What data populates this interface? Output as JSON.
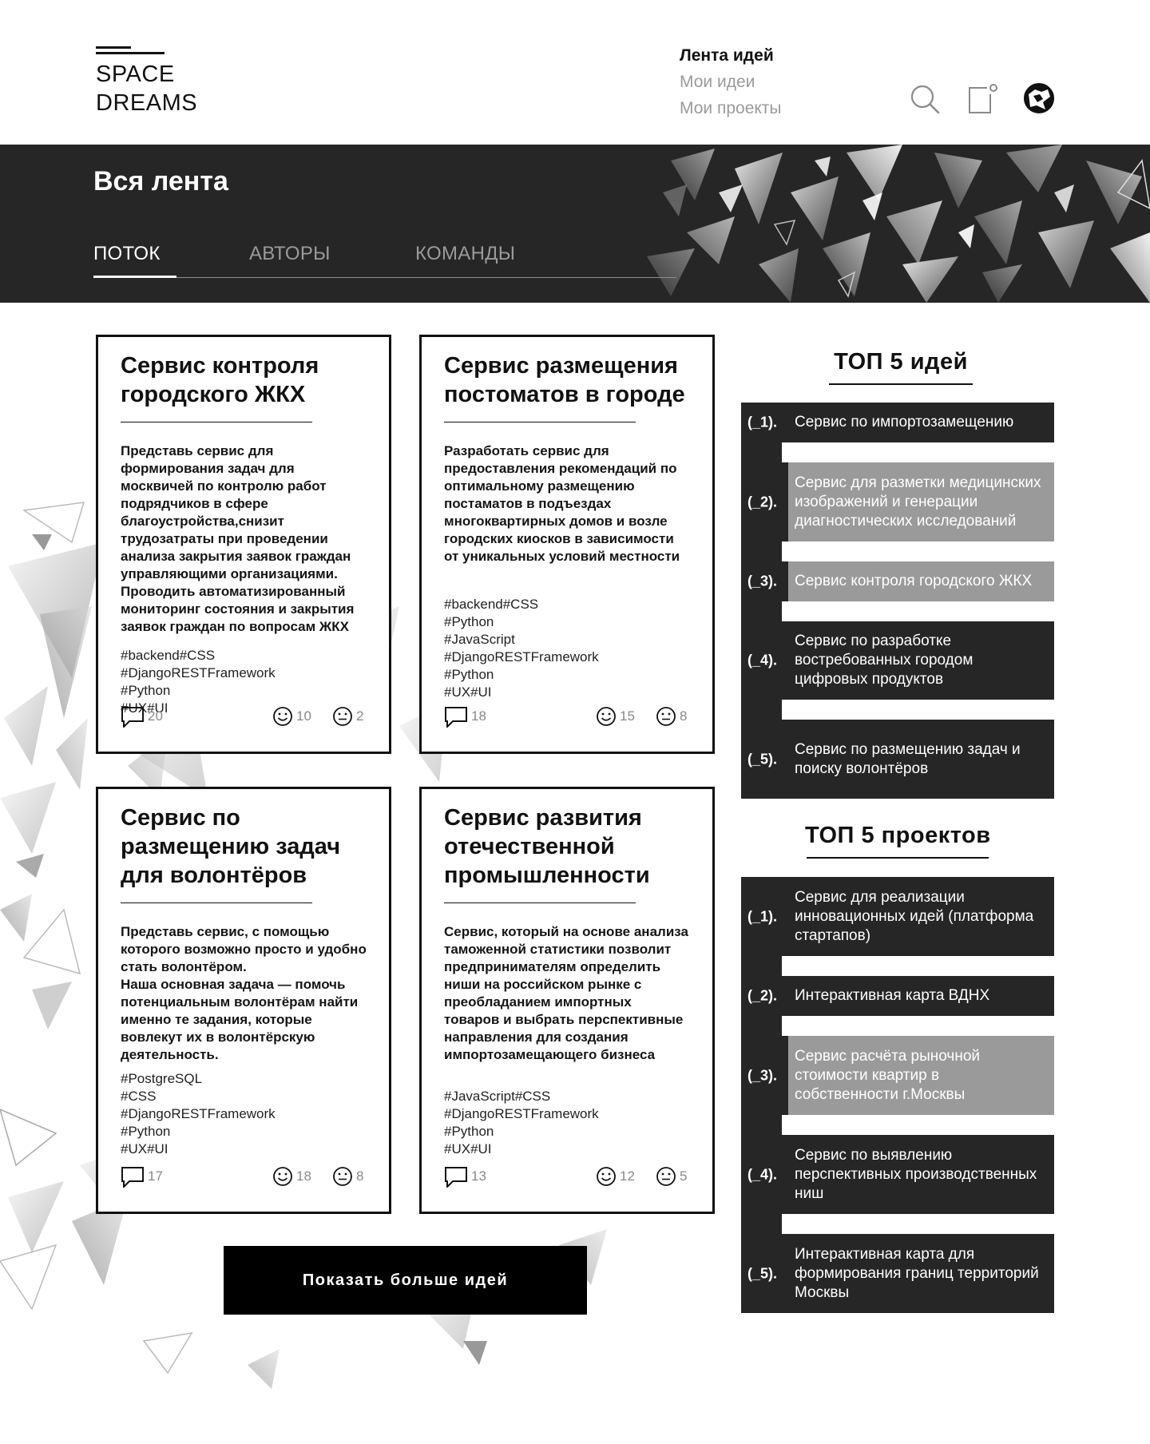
{
  "logo": {
    "line1": "SPACE",
    "line2": "DREAMS"
  },
  "nav": {
    "items": [
      {
        "label": "Лента идей",
        "active": true
      },
      {
        "label": "Мои идеи",
        "active": false
      },
      {
        "label": "Мои проекты",
        "active": false
      }
    ]
  },
  "header_icons": [
    "search-icon",
    "document-add-icon",
    "avatar"
  ],
  "banner": {
    "title": "Вся лента",
    "tabs": [
      "ПОТОК",
      "АВТОРЫ",
      "КОМАНДЫ"
    ],
    "active_tab": "ПОТОК"
  },
  "cards": [
    {
      "title": "Сервис контроля городского ЖКХ",
      "description": "Представь сервис для формирования задач для москвичей по контролю работ подрядчиков в сфере благоустройства,снизит трудозатраты при проведении анализа закрытия заявок граждан управляющими организациями. Проводить автоматизированный мониторинг состояния и закрытия заявок граждан по вопросам ЖКХ",
      "tags": [
        "#backend#CSS",
        "#DjangoRESTFramework",
        "#Python",
        "#UX#UI"
      ],
      "comments": "20",
      "likes": "10",
      "neutral": "2"
    },
    {
      "title": "Сервис размещения постоматов в городе",
      "description": "Разработать сервис для предоставления рекомендаций по оптимальному размещению постаматов в подъездах многоквартирных домов и возле городских киосков в зависимости от уникальных условий местности",
      "tags": [
        "#backend#CSS",
        "#Python",
        "#JavaScript",
        "#DjangoRESTFramework",
        "#Python",
        "#UX#UI"
      ],
      "comments": "18",
      "likes": "15",
      "neutral": "8"
    },
    {
      "title": "Сервис по размещению задач для волонтёров",
      "description": "Представь сервис,  с помощью которого возможно просто и удобно стать волонтёром.\nНаша основная задача — помочь потенциальным волонтёрам найти именно те задания, которые вовлекут их в  волонтёрскую деятельность.",
      "tags": [
        "#PostgreSQL",
        "#CSS",
        "#DjangoRESTFramework",
        "#Python",
        "#UX#UI"
      ],
      "comments": "17",
      "likes": "18",
      "neutral": "8"
    },
    {
      "title": "Сервис развития отечественной промышленности",
      "description": "Сервис, который на основе анализа таможенной статистики позволит предпринимателям определить ниши на российском рынке с преобладанием импортных товаров и выбрать перспективные направления для создания импортозамещающего бизнеса",
      "tags": [
        "#JavaScript#CSS",
        "#DjangoRESTFramework",
        "#Python",
        "#UX#UI"
      ],
      "comments": "13",
      "likes": "12",
      "neutral": "5"
    }
  ],
  "show_more_label": "Показать больше идей",
  "top_ideas": {
    "title": "ТОП 5 идей",
    "items": [
      {
        "num": "(_1).",
        "label": "Сервис по импортозамещению",
        "highlight": false
      },
      {
        "num": "(_2).",
        "label": "Сервис для разметки медицинских изображений и генерации диагностических исследований",
        "highlight": true
      },
      {
        "num": "(_3).",
        "label": "Сервис контроля городского ЖКХ",
        "highlight": true
      },
      {
        "num": "(_4).",
        "label": "Сервис по разработке востребованных городом цифровых продуктов",
        "highlight": false
      },
      {
        "num": "(_5).",
        "label": "Сервис по размещению задач и поиску волонтёров",
        "highlight": false
      }
    ]
  },
  "top_projects": {
    "title": "ТОП 5 проектов",
    "items": [
      {
        "num": "(_1).",
        "label": "Сервис для реализации инновационных идей (платформа стартапов)",
        "highlight": false
      },
      {
        "num": "(_2).",
        "label": "Интерактивная карта ВДНХ",
        "highlight": false
      },
      {
        "num": "(_3).",
        "label": "Сервис расчёта рыночной стоимости квартир в собственности г.Москвы",
        "highlight": true
      },
      {
        "num": "(_4).",
        "label": "Сервис по выявлению перспективных производственных ниш",
        "highlight": false
      },
      {
        "num": "(_5).",
        "label": "Интерактивная карта для формирования границ территорий Москвы",
        "highlight": false
      }
    ]
  },
  "colors": {
    "dark": "#262626",
    "highlight": "#9a9a9a",
    "nav_inactive": "#9a9a9a",
    "black": "#000000"
  }
}
